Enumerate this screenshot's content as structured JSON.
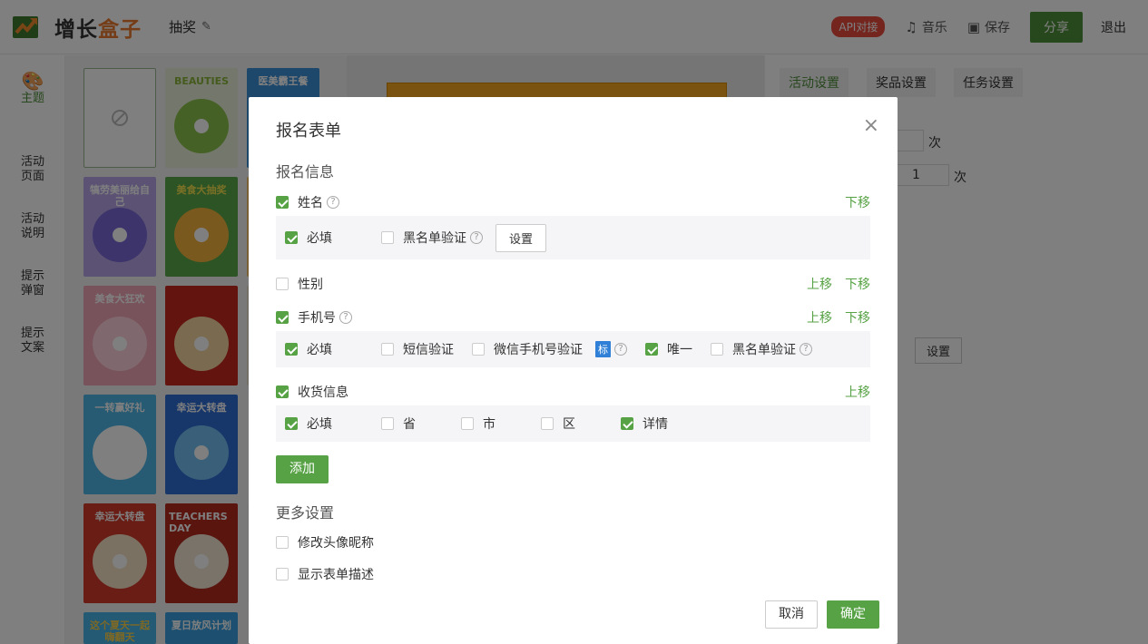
{
  "header": {
    "logo_text_a": "增长",
    "logo_text_b": "盒子",
    "title": "抽奖",
    "api_badge": "API对接",
    "music": "音乐",
    "save": "保存",
    "share": "分享",
    "exit": "退出"
  },
  "leftnav": {
    "items": [
      "主题",
      "活动\n页面",
      "活动\n说明",
      "提示\n弹窗",
      "提示\n文案"
    ]
  },
  "themes": [
    {
      "caption": "",
      "colors": [
        "#fff",
        "#fff"
      ]
    },
    {
      "caption": "BEAUTIES",
      "colors": [
        "#e9efd8",
        "#8bc34a"
      ]
    },
    {
      "caption": "医美霸王餐",
      "colors": [
        "#3b8fd6",
        "#f2c14e"
      ]
    },
    {
      "caption": "犒劳美丽给自己",
      "colors": [
        "#b9a7e8",
        "#7b68d6"
      ]
    },
    {
      "caption": "美食大抽奖",
      "colors": [
        "#5aa84a",
        "#f4b23c"
      ]
    },
    {
      "caption": "",
      "colors": [
        "#f3c26a",
        "#e07b2c"
      ]
    },
    {
      "caption": "美食大狂欢",
      "colors": [
        "#f3a7b9",
        "#ffd1dc"
      ]
    },
    {
      "caption": "",
      "colors": [
        "#c8291f",
        "#f5d6a0"
      ]
    },
    {
      "caption": "",
      "colors": [
        "#e9e0cf",
        "#c33"
      ]
    },
    {
      "caption": "一转赢好礼",
      "colors": [
        "#4fb6e6",
        "#ffffff"
      ]
    },
    {
      "caption": "幸运大转盘",
      "colors": [
        "#2f6ed6",
        "#74c0f2"
      ]
    },
    {
      "caption": "",
      "colors": [
        "#f5f5f5",
        "#ccc"
      ]
    },
    {
      "caption": "幸运大转盘",
      "colors": [
        "#d43b2a",
        "#f7e3c7"
      ]
    },
    {
      "caption": "TEACHERS DAY",
      "colors": [
        "#b52a1f",
        "#f2e6d3"
      ]
    },
    {
      "caption": "",
      "colors": [
        "#eee",
        "#ccc"
      ]
    },
    {
      "caption": "这个夏天一起嗨翻天",
      "colors": [
        "#4ab4e8",
        "#fbd34a"
      ]
    },
    {
      "caption": "夏日放风计划",
      "colors": [
        "#3aa1e0",
        "#fff"
      ]
    }
  ],
  "settings": {
    "tabs": [
      "活动设置",
      "奖品设置",
      "任务设置"
    ],
    "unit_a": "次",
    "value_b": "1",
    "unit_b": "次",
    "setting_btn": "设置"
  },
  "modal": {
    "title": "报名表单",
    "section_info": "报名信息",
    "fields": [
      {
        "label": "姓名",
        "checked": true,
        "help": true,
        "up": "",
        "down": "下移"
      },
      {
        "label": "性别",
        "checked": false,
        "help": false,
        "up": "上移",
        "down": "下移"
      },
      {
        "label": "手机号",
        "checked": true,
        "help": true,
        "up": "上移",
        "down": "下移"
      },
      {
        "label": "收货信息",
        "checked": true,
        "help": false,
        "up": "上移",
        "down": ""
      }
    ],
    "name_opts": {
      "required": "必填",
      "blacklist": "黑名单验证",
      "setting": "设置"
    },
    "phone_opts": {
      "required": "必填",
      "sms": "短信验证",
      "wechat": "微信手机号验证",
      "biao": "标",
      "unique": "唯一",
      "blacklist": "黑名单验证"
    },
    "addr_opts": {
      "required": "必填",
      "province": "省",
      "city": "市",
      "district": "区",
      "detail": "详情"
    },
    "add_btn": "添加",
    "section_more": "更多设置",
    "more": {
      "avatar": "修改头像昵称",
      "desc": "显示表单描述"
    },
    "cancel": "取消",
    "ok": "确定"
  }
}
